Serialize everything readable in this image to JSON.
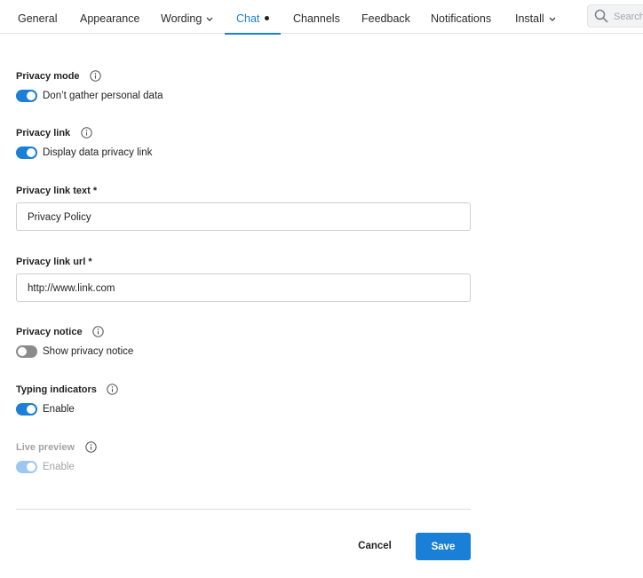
{
  "tabs": [
    {
      "label": "General"
    },
    {
      "label": "Appearance"
    },
    {
      "label": "Wording"
    },
    {
      "label": "Chat"
    },
    {
      "label": "Channels"
    },
    {
      "label": "Feedback"
    },
    {
      "label": "Notifications"
    },
    {
      "label": "Install"
    }
  ],
  "active_tab": "Chat",
  "search": {
    "placeholder": "Search"
  },
  "form": {
    "privacy_mode": {
      "label": "Privacy mode",
      "toggle_label": "Don’t gather personal data",
      "enabled": true
    },
    "privacy_link": {
      "label": "Privacy link",
      "toggle_label": "Display data privacy link",
      "enabled": true
    },
    "privacy_link_text": {
      "label": "Privacy link text *",
      "value": "Privacy Policy"
    },
    "privacy_link_url": {
      "label": "Privacy link url *",
      "value": "http://www.link.com"
    },
    "privacy_notice": {
      "label": "Privacy notice",
      "toggle_label": "Show privacy notice",
      "enabled": false
    },
    "typing_indicators": {
      "label": "Typing indicators",
      "toggle_label": "Enable",
      "enabled": true
    },
    "live_preview": {
      "label": "Live preview",
      "toggle_label": "Enable",
      "enabled": true,
      "disabled": true
    }
  },
  "buttons": {
    "cancel": "Cancel",
    "save": "Save"
  },
  "colors": {
    "accent": "#1a7fd6",
    "toggle_off": "#8b8b8b",
    "toggle_disabled": "#9cc8ef"
  },
  "icons": [
    "search-icon",
    "info-icon",
    "chevron-down-icon"
  ]
}
